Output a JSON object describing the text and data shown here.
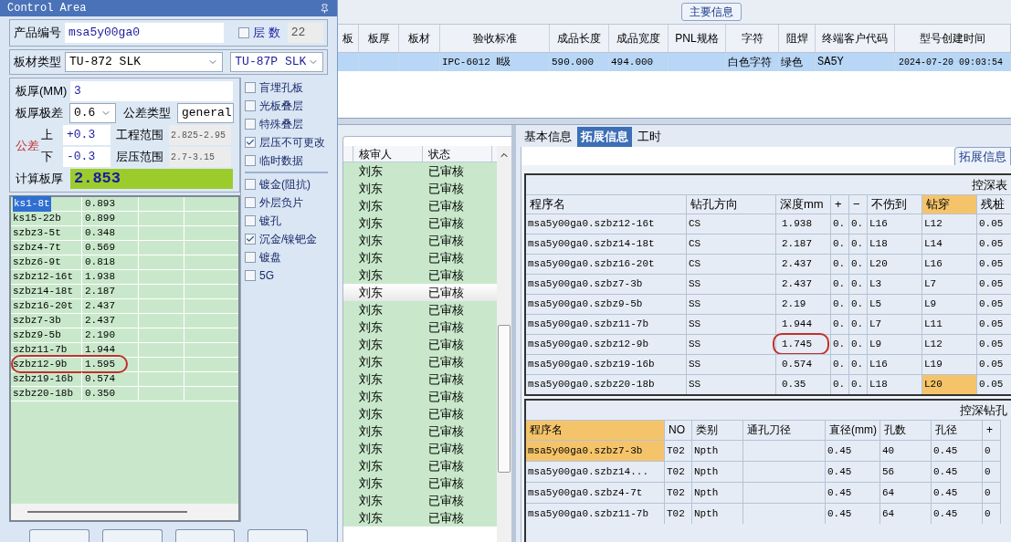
{
  "control_area": {
    "title": "Control Area",
    "product_number": {
      "label": "产品编号",
      "value": "msa5y00ga0"
    },
    "layer_count": {
      "label": "层 数",
      "checked": false,
      "value": "22"
    },
    "board_material": {
      "label": "板材类型",
      "value": "TU-872 SLK",
      "value_2": "TU-87P SLK"
    },
    "board_thickness": {
      "label": "板厚(MM)",
      "value": "3"
    },
    "thickness_tolerance": {
      "label": "板厚极差",
      "value": "0.6"
    },
    "tolerance_type": {
      "label": "公差类型",
      "value": "general"
    },
    "tolerance": {
      "label": "公差",
      "upper_label": "上",
      "upper": "+0.3",
      "lower_label": "下",
      "lower": "-0.3"
    },
    "engineering_range": {
      "label": "工程范围",
      "value": "2.825-2.95"
    },
    "lamination_range": {
      "label": "层压范围",
      "value": "2.7-3.15"
    },
    "calculated_thickness": {
      "label": "计算板厚",
      "value": "2.853"
    },
    "options": [
      {
        "label": "盲埋孔板",
        "checked": false
      },
      {
        "label": "光板叠层",
        "checked": false
      },
      {
        "label": "特殊叠层",
        "checked": false
      },
      {
        "label": "层压不可更改",
        "checked": true
      },
      {
        "label": "临时数据",
        "checked": false
      }
    ],
    "options_2": [
      {
        "label": "镀金(阻抗)",
        "checked": false
      },
      {
        "label": "外层负片",
        "checked": false
      },
      {
        "label": "镀孔",
        "checked": false
      },
      {
        "label": "沉金/镍钯金",
        "checked": true
      },
      {
        "label": "镀盘",
        "checked": false
      },
      {
        "label": "5G",
        "checked": false
      }
    ],
    "layers": [
      {
        "name": "ks1-8t",
        "value": "0.893",
        "selected": true,
        "circled": false
      },
      {
        "name": "ks15-22b",
        "value": "0.899",
        "selected": false,
        "circled": false
      },
      {
        "name": "szbz3-5t",
        "value": "0.348",
        "selected": false,
        "circled": false
      },
      {
        "name": "szbz4-7t",
        "value": "0.569",
        "selected": false,
        "circled": false
      },
      {
        "name": "szbz6-9t",
        "value": "0.818",
        "selected": false,
        "circled": false
      },
      {
        "name": "szbz12-16t",
        "value": "1.938",
        "selected": false,
        "circled": false
      },
      {
        "name": "szbz14-18t",
        "value": "2.187",
        "selected": false,
        "circled": false
      },
      {
        "name": "szbz16-20t",
        "value": "2.437",
        "selected": false,
        "circled": false
      },
      {
        "name": "szbz7-3b",
        "value": "2.437",
        "selected": false,
        "circled": false
      },
      {
        "name": "szbz9-5b",
        "value": "2.190",
        "selected": false,
        "circled": false
      },
      {
        "name": "szbz11-7b",
        "value": "1.944",
        "selected": false,
        "circled": false
      },
      {
        "name": "szbz12-9b",
        "value": "1.595",
        "selected": false,
        "circled": true
      },
      {
        "name": "szbz19-16b",
        "value": "0.574",
        "selected": false,
        "circled": false
      },
      {
        "name": "szbz20-18b",
        "value": "0.350",
        "selected": false,
        "circled": false
      }
    ]
  },
  "main_info": {
    "title": "主要信息",
    "columns": [
      "板",
      "板厚",
      "板材",
      "验收标准",
      "成品长度",
      "成品宽度",
      "PNL规格",
      "字符",
      "阻焊",
      "终端客户代码",
      "型号创建时间"
    ],
    "rows": [
      {
        "selected": true,
        "cells": [
          "",
          "",
          "",
          "IPC-6012 Ⅱ级",
          "590.000",
          "494.000",
          "",
          "白色字符",
          "绿色",
          "SA5Y",
          "2024-07-20 09:03:54"
        ]
      }
    ]
  },
  "review_list": {
    "columns": [
      "核审人",
      "状态"
    ],
    "rows": [
      {
        "reviewer": "刘东",
        "status": "已审核",
        "selected": false
      },
      {
        "reviewer": "刘东",
        "status": "已审核",
        "selected": false
      },
      {
        "reviewer": "刘东",
        "status": "已审核",
        "selected": false
      },
      {
        "reviewer": "刘东",
        "status": "已审核",
        "selected": false
      },
      {
        "reviewer": "刘东",
        "status": "已审核",
        "selected": false
      },
      {
        "reviewer": "刘东",
        "status": "已审核",
        "selected": false
      },
      {
        "reviewer": "刘东",
        "status": "已审核",
        "selected": false
      },
      {
        "reviewer": "刘东",
        "status": "已审核",
        "selected": true
      },
      {
        "reviewer": "刘东",
        "status": "已审核",
        "selected": false
      },
      {
        "reviewer": "刘东",
        "status": "已审核",
        "selected": false
      },
      {
        "reviewer": "刘东",
        "status": "已审核",
        "selected": false
      },
      {
        "reviewer": "刘东",
        "status": "已审核",
        "selected": false
      },
      {
        "reviewer": "刘东",
        "status": "已审核",
        "selected": false
      },
      {
        "reviewer": "刘东",
        "status": "已审核",
        "selected": false
      },
      {
        "reviewer": "刘东",
        "status": "已审核",
        "selected": false
      },
      {
        "reviewer": "刘东",
        "status": "已审核",
        "selected": false
      },
      {
        "reviewer": "刘东",
        "status": "已审核",
        "selected": false
      },
      {
        "reviewer": "刘东",
        "status": "已审核",
        "selected": false
      },
      {
        "reviewer": "刘东",
        "status": "已审核",
        "selected": false
      },
      {
        "reviewer": "刘东",
        "status": "已审核",
        "selected": false
      },
      {
        "reviewer": "刘东",
        "status": "已审核",
        "selected": false
      }
    ]
  },
  "detail_tabs": [
    {
      "label": "基本信息",
      "selected": false
    },
    {
      "label": "拓展信息",
      "selected": true
    },
    {
      "label": "工时",
      "selected": false
    }
  ],
  "group_label": "拓展信息",
  "depth_table": {
    "title": "控深表",
    "columns": [
      {
        "label": "程序名",
        "highlighted": false
      },
      {
        "label": "钻孔方向",
        "highlighted": false
      },
      {
        "label": "深度mm",
        "highlighted": false
      },
      {
        "label": "+",
        "highlighted": false
      },
      {
        "label": "−",
        "highlighted": false
      },
      {
        "label": "不伤到",
        "highlighted": false
      },
      {
        "label": "钻穿",
        "highlighted": true
      },
      {
        "label": "残桩",
        "highlighted": false
      }
    ],
    "rows": [
      {
        "circled": false,
        "highlighted": false,
        "cells": [
          "msa5y00ga0.szbz12-16t",
          "CS",
          "1.938",
          "0.",
          "0.",
          "L16",
          "L12",
          "0.05"
        ]
      },
      {
        "circled": false,
        "highlighted": false,
        "cells": [
          "msa5y00ga0.szbz14-18t",
          "CS",
          "2.187",
          "0.",
          "0.",
          "L18",
          "L14",
          "0.05"
        ]
      },
      {
        "circled": false,
        "highlighted": false,
        "cells": [
          "msa5y00ga0.szbz16-20t",
          "CS",
          "2.437",
          "0.",
          "0.",
          "L20",
          "L16",
          "0.05"
        ]
      },
      {
        "circled": false,
        "highlighted": false,
        "cells": [
          "msa5y00ga0.szbz7-3b",
          "SS",
          "2.437",
          "0.",
          "0.",
          "L3",
          "L7",
          "0.05"
        ]
      },
      {
        "circled": false,
        "highlighted": false,
        "cells": [
          "msa5y00ga0.szbz9-5b",
          "SS",
          "2.19",
          "0.",
          "0.",
          "L5",
          "L9",
          "0.05"
        ]
      },
      {
        "circled": false,
        "highlighted": false,
        "cells": [
          "msa5y00ga0.szbz11-7b",
          "SS",
          "1.944",
          "0.",
          "0.",
          "L7",
          "L11",
          "0.05"
        ]
      },
      {
        "circled": true,
        "highlighted": false,
        "cells": [
          "msa5y00ga0.szbz12-9b",
          "SS",
          "1.745",
          "0.",
          "0.",
          "L9",
          "L12",
          "0.05"
        ]
      },
      {
        "circled": false,
        "highlighted": false,
        "cells": [
          "msa5y00ga0.szbz19-16b",
          "SS",
          "0.574",
          "0.",
          "0.",
          "L16",
          "L19",
          "0.05"
        ]
      },
      {
        "circled": false,
        "highlighted": true,
        "cells": [
          "msa5y00ga0.szbz20-18b",
          "SS",
          "0.35",
          "0.",
          "0.",
          "L18",
          "L20",
          "0.05"
        ]
      }
    ]
  },
  "drill_table": {
    "title": "控深钻孔",
    "columns": [
      {
        "label": "程序名",
        "highlighted": true
      },
      {
        "label": "NO",
        "highlighted": false
      },
      {
        "label": "类别",
        "highlighted": false
      },
      {
        "label": "通孔刀径",
        "highlighted": false
      },
      {
        "label": "直径(mm)",
        "highlighted": false
      },
      {
        "label": "孔数",
        "highlighted": false
      },
      {
        "label": "孔径",
        "highlighted": false
      },
      {
        "label": "+",
        "highlighted": false
      }
    ],
    "rows": [
      {
        "selected": true,
        "cells": [
          "msa5y00ga0.szbz7-3b",
          "T02",
          "Npth",
          "",
          "0.45",
          "40",
          "0.45",
          "0"
        ]
      },
      {
        "selected": false,
        "cells": [
          "msa5y00ga0.szbz14...",
          "T02",
          "Npth",
          "",
          "0.45",
          "56",
          "0.45",
          "0"
        ]
      },
      {
        "selected": false,
        "cells": [
          "msa5y00ga0.szbz4-7t",
          "T02",
          "Npth",
          "",
          "0.45",
          "64",
          "0.45",
          "0"
        ]
      },
      {
        "selected": false,
        "cells": [
          "msa5y00ga0.szbz11-7b",
          "T02",
          "Npth",
          "",
          "0.45",
          "64",
          "0.45",
          "0"
        ]
      }
    ]
  }
}
